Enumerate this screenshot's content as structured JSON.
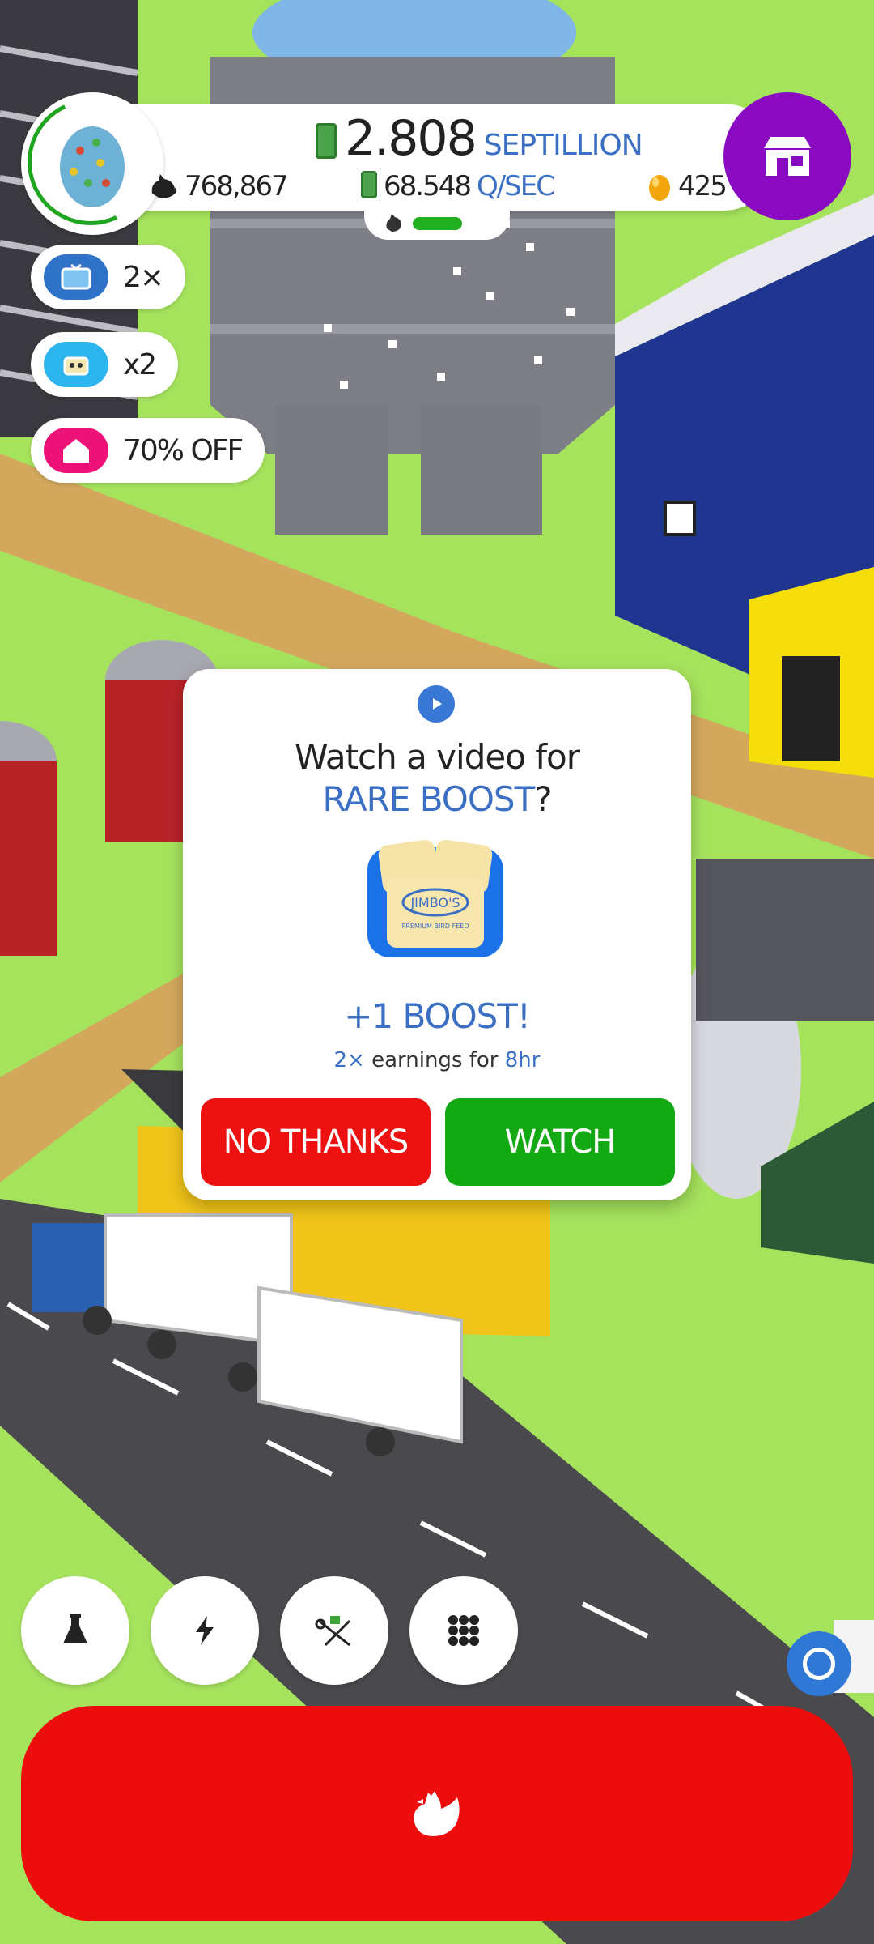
{
  "hud": {
    "money_value": "2.808",
    "money_unit": "SEPTILLION",
    "chickens": "768,867",
    "rate_value": "68.548",
    "rate_unit": "Q/SEC",
    "golden_eggs": "425",
    "progress_fraction": 0.55,
    "shop_color": "#8a0ac2"
  },
  "boosters": [
    {
      "icon": "tv-icon",
      "label": "2×",
      "color": "#2f73c9"
    },
    {
      "icon": "cat-boost-icon",
      "label": "x2",
      "color": "#2cb5ef"
    },
    {
      "icon": "house-icon",
      "label": "70% OFF",
      "color": "#ee1177"
    }
  ],
  "modal": {
    "line1": "Watch a video for",
    "line2_highlight": "RARE BOOST",
    "line2_suffix": "?",
    "bag_brand": "JIMBO'S",
    "bag_subtitle": "PREMIUM BIRD FEED",
    "boost_title": "+1 BOOST!",
    "earn_multiplier": "2×",
    "earn_mid": " earnings for ",
    "earn_duration": "8hr",
    "no_label": "NO THANKS",
    "watch_label": "WATCH"
  },
  "bottom_buttons": [
    "flask-icon",
    "lightning-icon",
    "drone-icon",
    "grid-menu-icon"
  ],
  "colors": {
    "grass": "#a6e35d",
    "road": "#4a4a4e",
    "hatch_button": "#ee0d0d",
    "accent_blue": "#3a6fc4",
    "watch_green": "#13a913",
    "no_red": "#ee1111"
  }
}
